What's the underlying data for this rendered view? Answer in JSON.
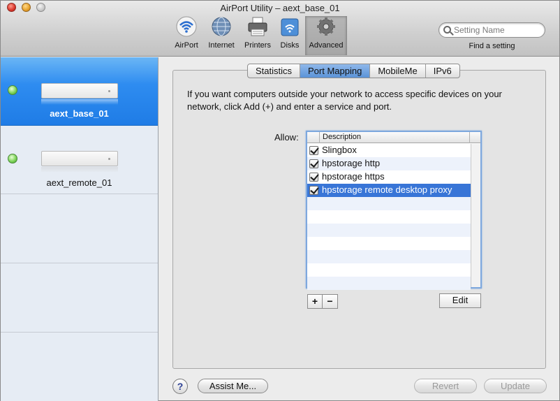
{
  "window": {
    "title": "AirPort Utility – aext_base_01"
  },
  "toolbar": {
    "items": [
      {
        "label": "AirPort",
        "icon": "wifi-icon"
      },
      {
        "label": "Internet",
        "icon": "globe-icon"
      },
      {
        "label": "Printers",
        "icon": "printer-icon"
      },
      {
        "label": "Disks",
        "icon": "disk-icon"
      },
      {
        "label": "Advanced",
        "icon": "gear-icon",
        "active": true
      }
    ],
    "search": {
      "placeholder": "Setting Name",
      "caption": "Find a setting"
    }
  },
  "sidebar": {
    "devices": [
      {
        "name": "aext_base_01",
        "selected": true,
        "status_color": "#6cc94a"
      },
      {
        "name": "aext_remote_01",
        "selected": false,
        "status_color": "#6cc94a"
      }
    ]
  },
  "tabs": [
    {
      "label": "Statistics"
    },
    {
      "label": "Port Mapping",
      "active": true
    },
    {
      "label": "MobileMe"
    },
    {
      "label": "IPv6"
    }
  ],
  "main": {
    "description": "If you want computers outside your network to access specific devices on your network, click Add (+) and enter a service and port.",
    "allow_label": "Allow:",
    "list": {
      "column_header": "Description",
      "rows": [
        {
          "label": "Slingbox",
          "checked": true
        },
        {
          "label": "hpstorage http",
          "checked": true
        },
        {
          "label": "hpstorage https",
          "checked": true
        },
        {
          "label": "hpstorage remote desktop proxy",
          "checked": true,
          "selected": true
        }
      ]
    },
    "add_label": "+",
    "remove_label": "−",
    "edit_label": "Edit"
  },
  "footer": {
    "help_label": "?",
    "assist_label": "Assist Me...",
    "revert_label": "Revert",
    "update_label": "Update"
  },
  "colors": {
    "selection": "#3875d7",
    "sidebar_selected": "#2e8cf0",
    "accent": "#5b93d8"
  }
}
